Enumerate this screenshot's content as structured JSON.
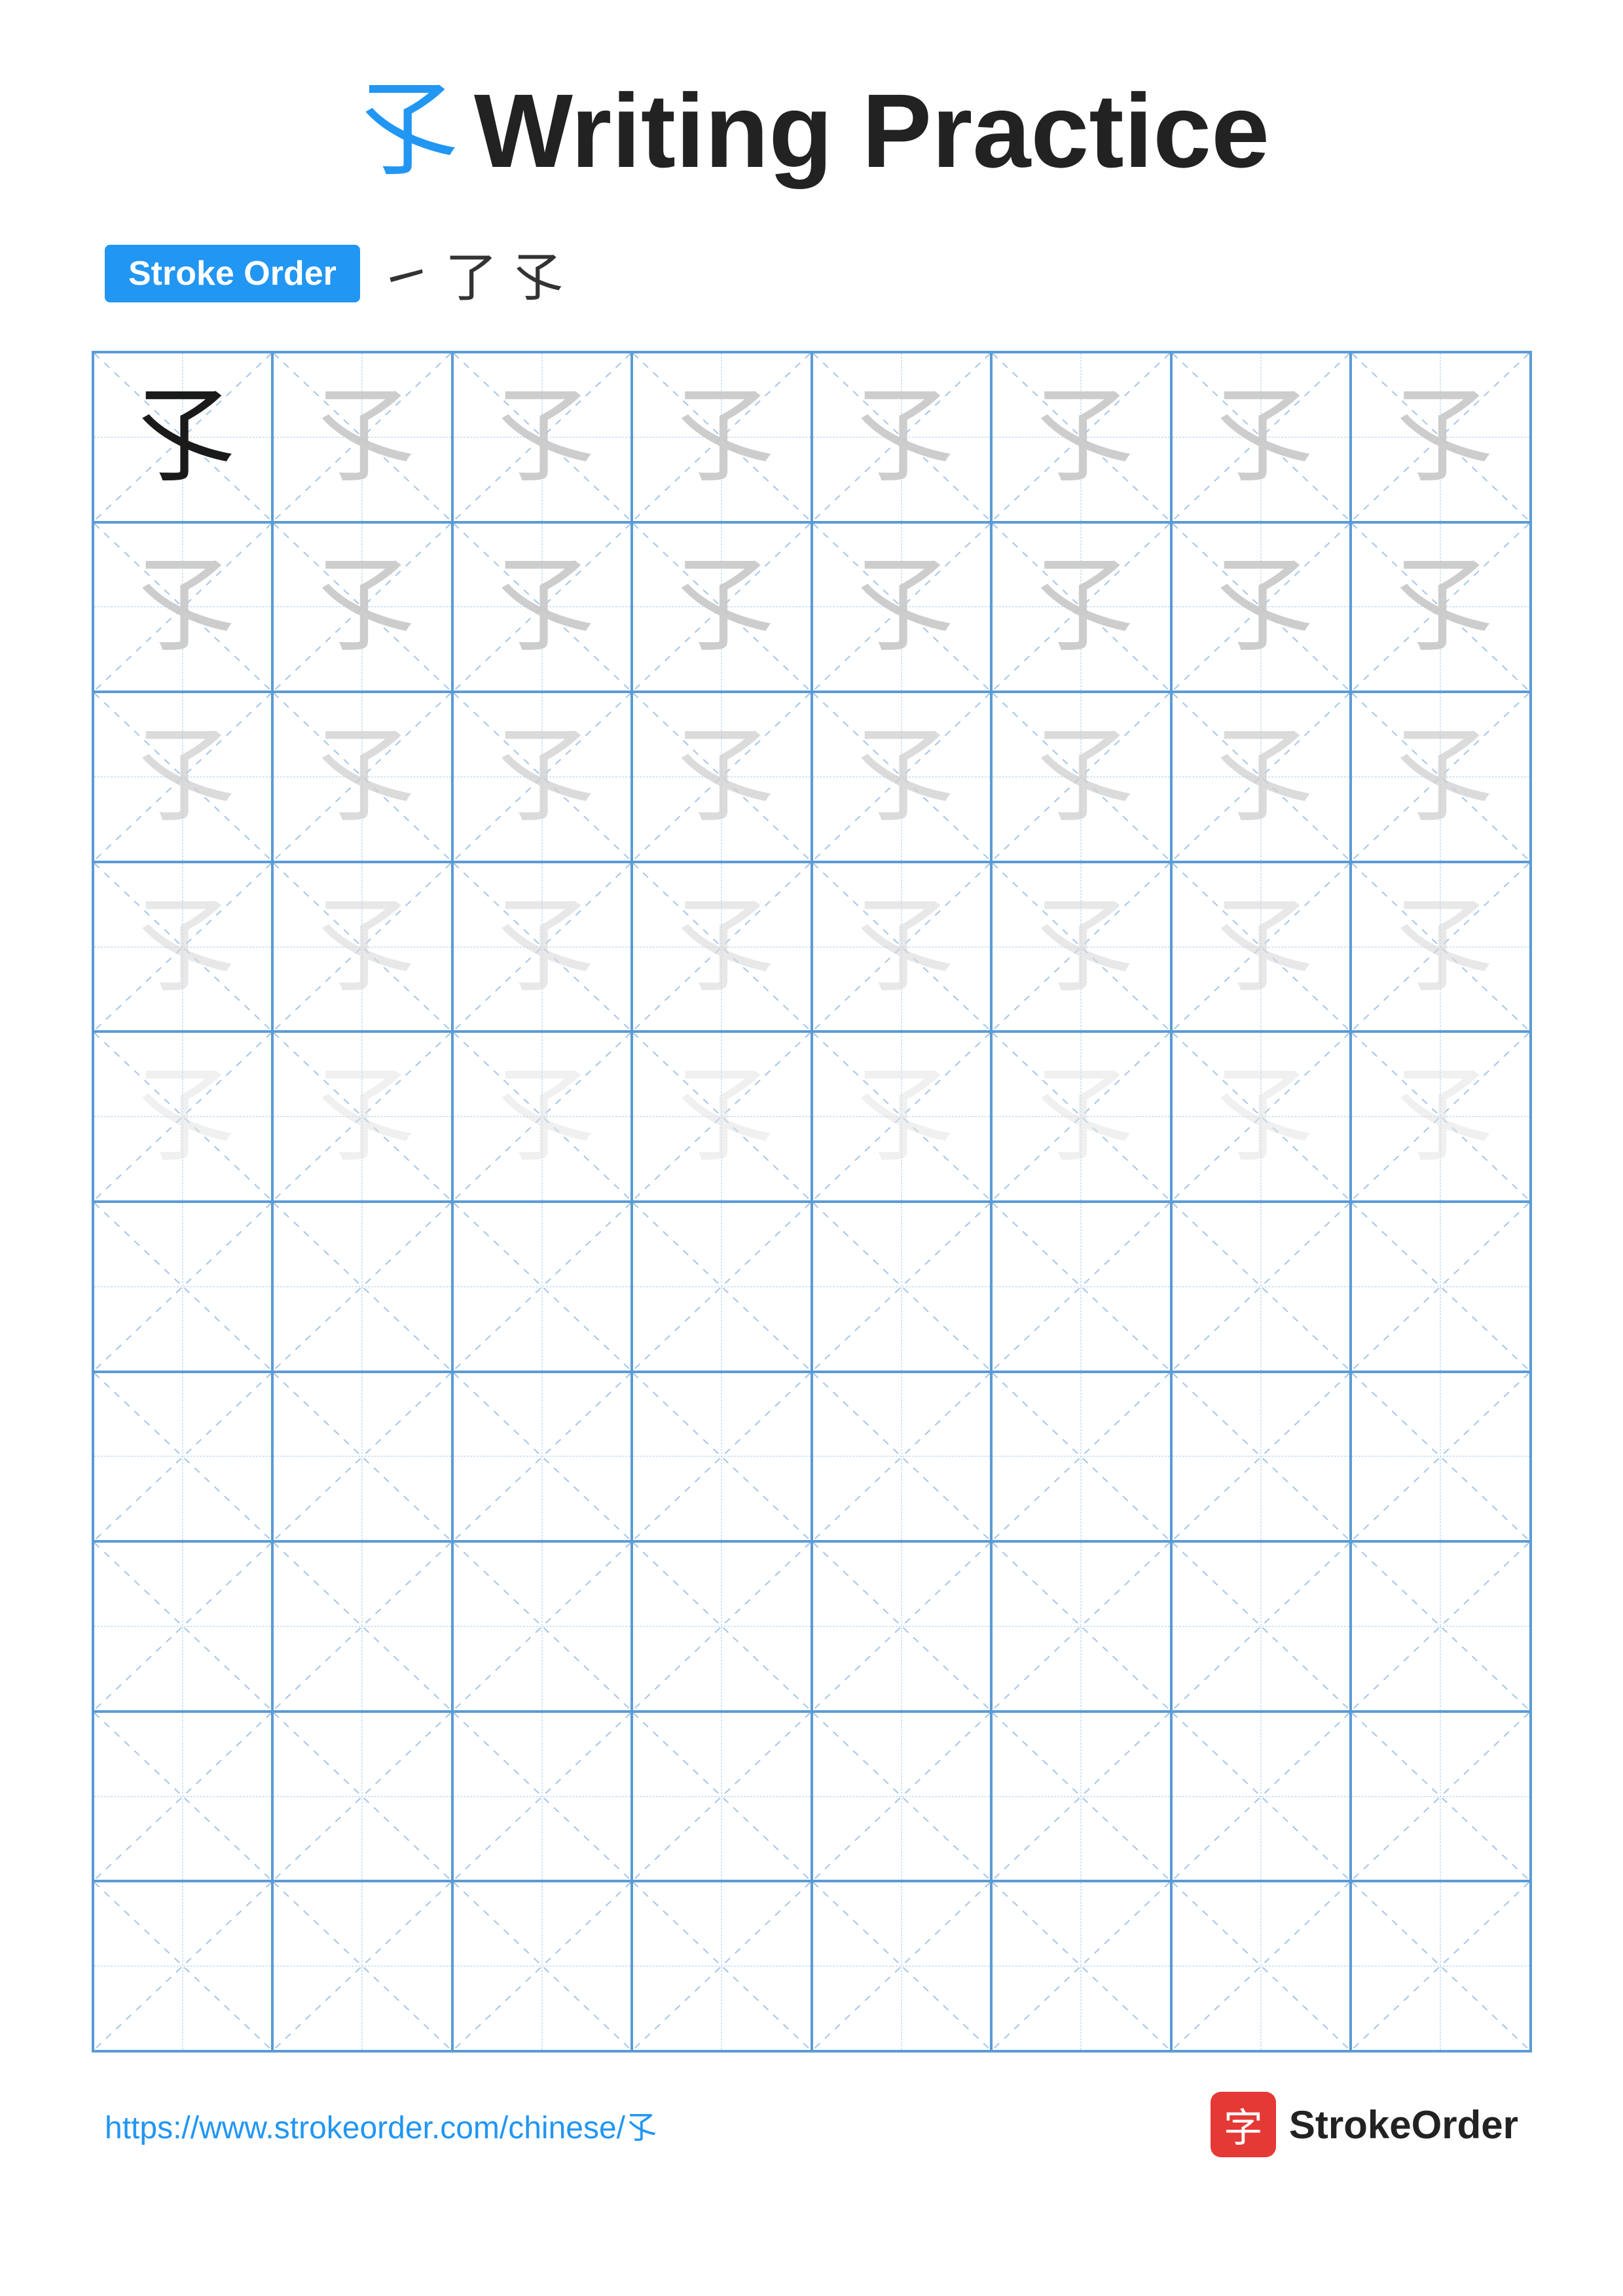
{
  "title": {
    "char": "孓",
    "text": "Writing Practice",
    "char_display": "孓"
  },
  "stroke_order": {
    "badge_label": "Stroke Order",
    "steps": [
      "㇀",
      "了",
      "孓"
    ]
  },
  "grid": {
    "cols": 8,
    "rows": 10,
    "character": "孓",
    "filled_rows": 5
  },
  "footer": {
    "url": "https://www.strokeorder.com/chinese/孓",
    "brand_char": "字",
    "brand_name": "StrokeOrder"
  }
}
